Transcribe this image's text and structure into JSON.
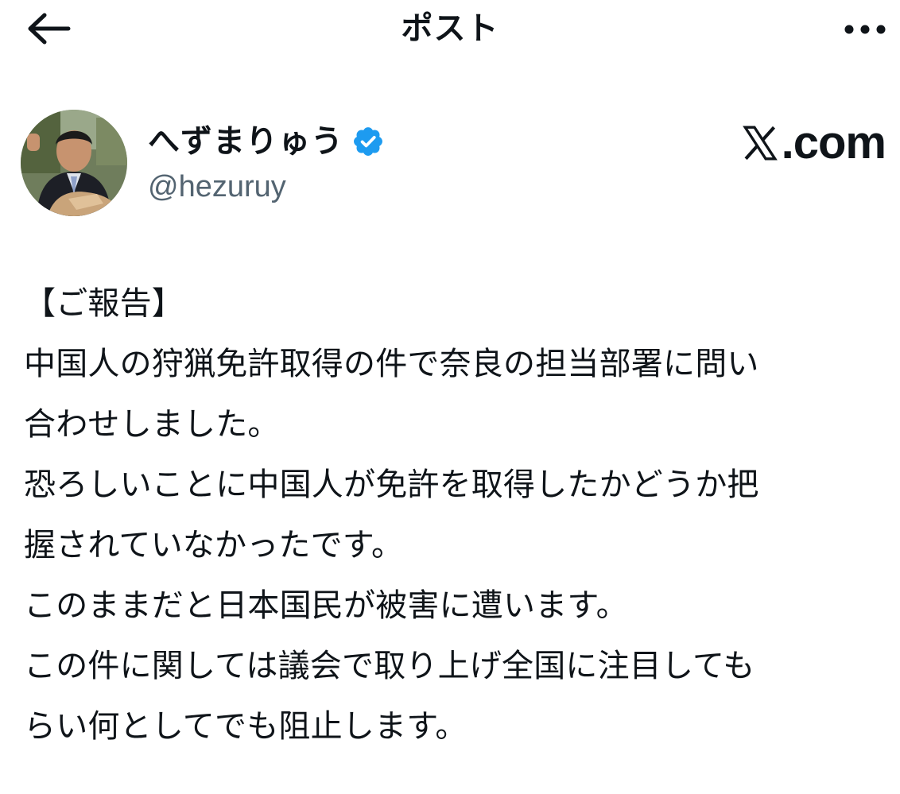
{
  "header": {
    "title": "ポスト",
    "back_icon": "arrow-left-icon",
    "more_icon": "ellipsis-icon"
  },
  "author": {
    "display_name": "へずまりゅう",
    "handle": "@hezuruy",
    "verified": true,
    "verified_color": "#1d9bf0"
  },
  "source": {
    "label": ".com",
    "logo_icon": "x-logo-icon"
  },
  "post": {
    "lines": [
      "【ご報告】",
      "中国人の狩猟免許取得の件で奈良の担当部署に問い",
      "合わせしました。",
      "恐ろしいことに中国人が免許を取得したかどうか把",
      "握されていなかったです。",
      "このままだと日本国民が被害に遭います。",
      "この件に関しては議会で取り上げ全国に注目しても",
      "らい何としてでも阻止します。"
    ]
  },
  "colors": {
    "text": "#0f1419",
    "secondary_text": "#536471",
    "accent": "#1d9bf0",
    "background": "#ffffff"
  }
}
